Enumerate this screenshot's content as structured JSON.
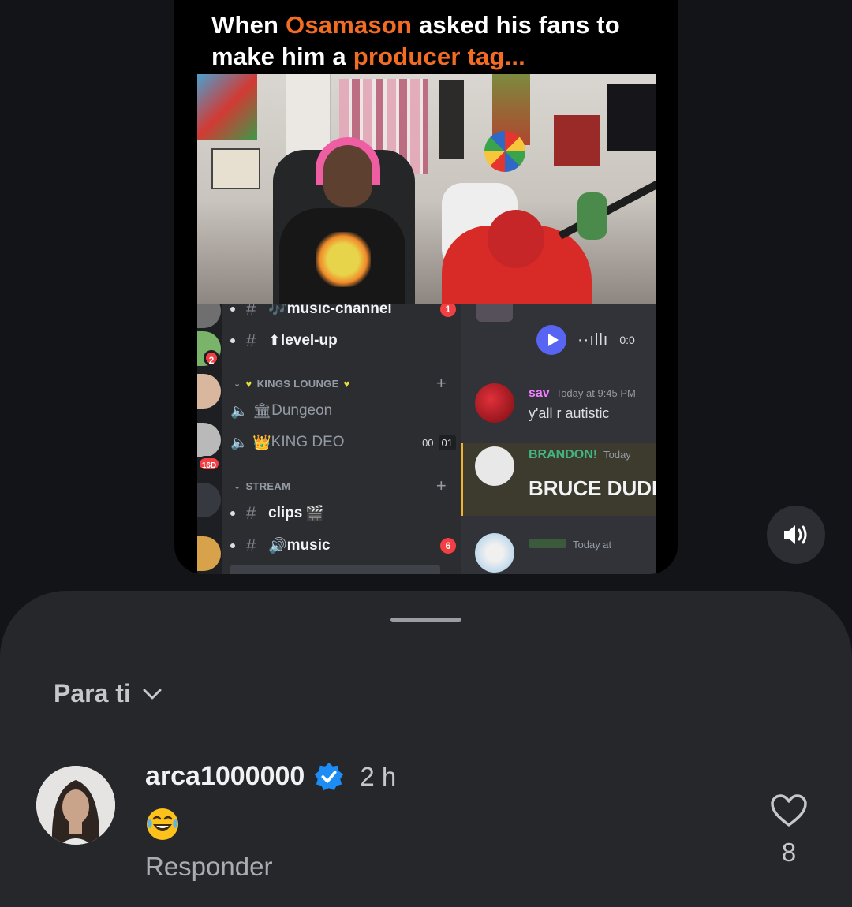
{
  "video": {
    "caption": {
      "part1": "When ",
      "highlight1": "Osamason",
      "part2": " asked his fans to make him a ",
      "highlight2": "producer tag..."
    },
    "highlight_color": "#f26c24",
    "discord": {
      "channels": [
        {
          "name": "music-channel",
          "prefix": "🎶",
          "badge": "1"
        },
        {
          "name": "level-up",
          "prefix": "⬆",
          "badge": ""
        }
      ],
      "category_kings": "KINGS LOUNGE",
      "voice_channels": [
        {
          "name": "Dungeon",
          "prefix": "🏛"
        },
        {
          "name": "KING DEO",
          "prefix": "👑",
          "counter_a": "00",
          "counter_b": "01"
        }
      ],
      "category_stream": "STREAM",
      "stream_channels": [
        {
          "name": "clips",
          "suffix": "🎬",
          "badge": ""
        },
        {
          "name": "music",
          "prefix": "🔊",
          "badge": "6"
        }
      ],
      "guild_badges": [
        "2",
        "16D"
      ],
      "audio_time": "0:0",
      "messages": [
        {
          "author": "sav",
          "time": "Today at 9:45 PM",
          "text": "y'all r autistic",
          "color": "#f47fff"
        },
        {
          "author": "BRANDON!",
          "time": "Today",
          "text": "BRUCE DUDE",
          "color": "#43b581"
        },
        {
          "author": "",
          "time": "Today at",
          "text": ""
        }
      ]
    }
  },
  "controls": {
    "volume_icon": "speaker-on-icon"
  },
  "comments": {
    "filter_label": "Para ti",
    "items": [
      {
        "username": "arca1000000",
        "verified": true,
        "time": "2 h",
        "text": "😂",
        "reply_label": "Responder",
        "likes": "8"
      }
    ]
  }
}
